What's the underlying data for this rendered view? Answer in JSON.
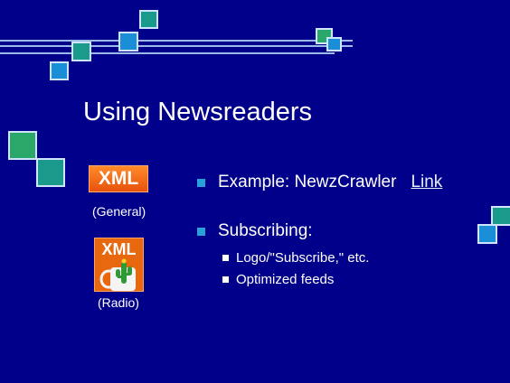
{
  "slide": {
    "title": "Using Newsreaders",
    "bullets": [
      {
        "text": "Example: NewzCrawler",
        "link": "Link"
      },
      {
        "text": "Subscribing:"
      }
    ],
    "sub_bullets": [
      "Logo/\"Subscribe,\" etc.",
      "Optimized feeds"
    ]
  },
  "icons": {
    "general": {
      "badge": "XML",
      "caption": "(General)"
    },
    "radio": {
      "badge": "XML",
      "caption": "(Radio)"
    }
  },
  "colors": {
    "background": "#00008b",
    "accent_blue": "#1a8fd8",
    "accent_teal": "#1a9a8a",
    "accent_green": "#2aa86a",
    "bullet": "#2aa0d8",
    "xml_orange": "#f06a14"
  }
}
